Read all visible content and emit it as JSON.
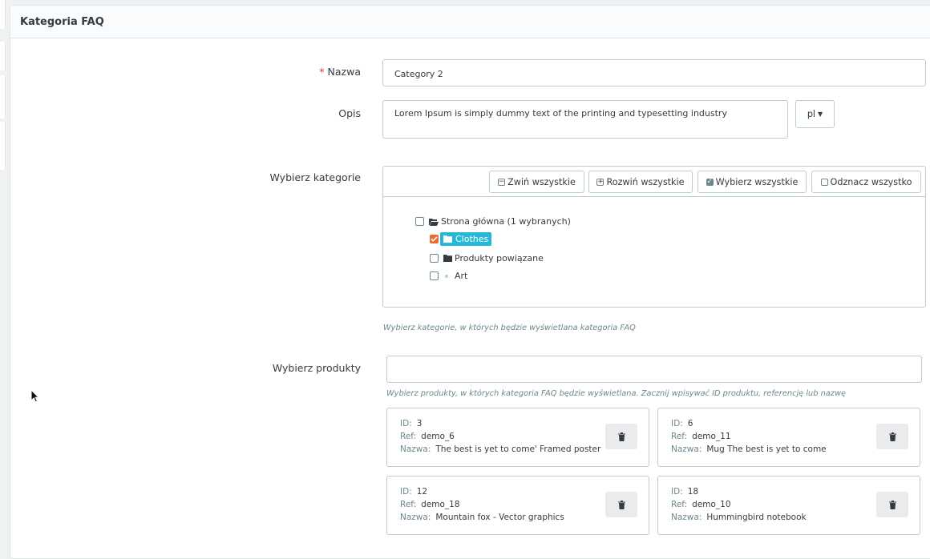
{
  "panel": {
    "title": "Kategoria FAQ"
  },
  "form": {
    "name": {
      "label": "Nazwa",
      "required_mark": "*",
      "value": "Category 2"
    },
    "description": {
      "label": "Opis",
      "value": "Lorem Ipsum is simply dummy text of the printing and typesetting industry",
      "lang": "pl"
    },
    "categories": {
      "label": "Wybierz kategorie",
      "buttons": {
        "collapse": "Zwiń wszystkie",
        "expand": "Rozwiń wszystkie",
        "select_all": "Wybierz wszystkie",
        "unselect_all": "Odznacz wszystko"
      },
      "tree": [
        {
          "label": "Strona główna (1 wybranych)",
          "checked": false,
          "icon": "folder-open-icon"
        },
        {
          "label": "Clothes",
          "checked": true,
          "icon": "folder-icon"
        },
        {
          "label": "Produkty powiązane",
          "checked": false,
          "icon": "folder-icon"
        },
        {
          "label": "Art",
          "checked": false,
          "icon": "bullet-icon"
        }
      ],
      "help": "Wybierz kategorie, w których będzie wyświetlana kategoria FAQ"
    },
    "products": {
      "label": "Wybierz produkty",
      "search_value": "",
      "help": "Wybierz produkty, w których kategoria FAQ będzie wyświetlana. Zacznij wpisywać ID produktu, referencję lub nazwę",
      "keys": {
        "id": "ID:",
        "ref": "Ref:",
        "name": "Nazwa:"
      },
      "items": [
        {
          "id": "3",
          "ref": "demo_6",
          "name": "The best is yet to come' Framed poster"
        },
        {
          "id": "6",
          "ref": "demo_11",
          "name": "Mug The best is yet to come"
        },
        {
          "id": "12",
          "ref": "demo_18",
          "name": "Mountain fox - Vector graphics"
        },
        {
          "id": "18",
          "ref": "demo_10",
          "name": "Hummingbird notebook"
        }
      ]
    }
  },
  "colors": {
    "accent": "#25b9d7",
    "checked": "#ee6b2c",
    "required": "#e5343b"
  }
}
